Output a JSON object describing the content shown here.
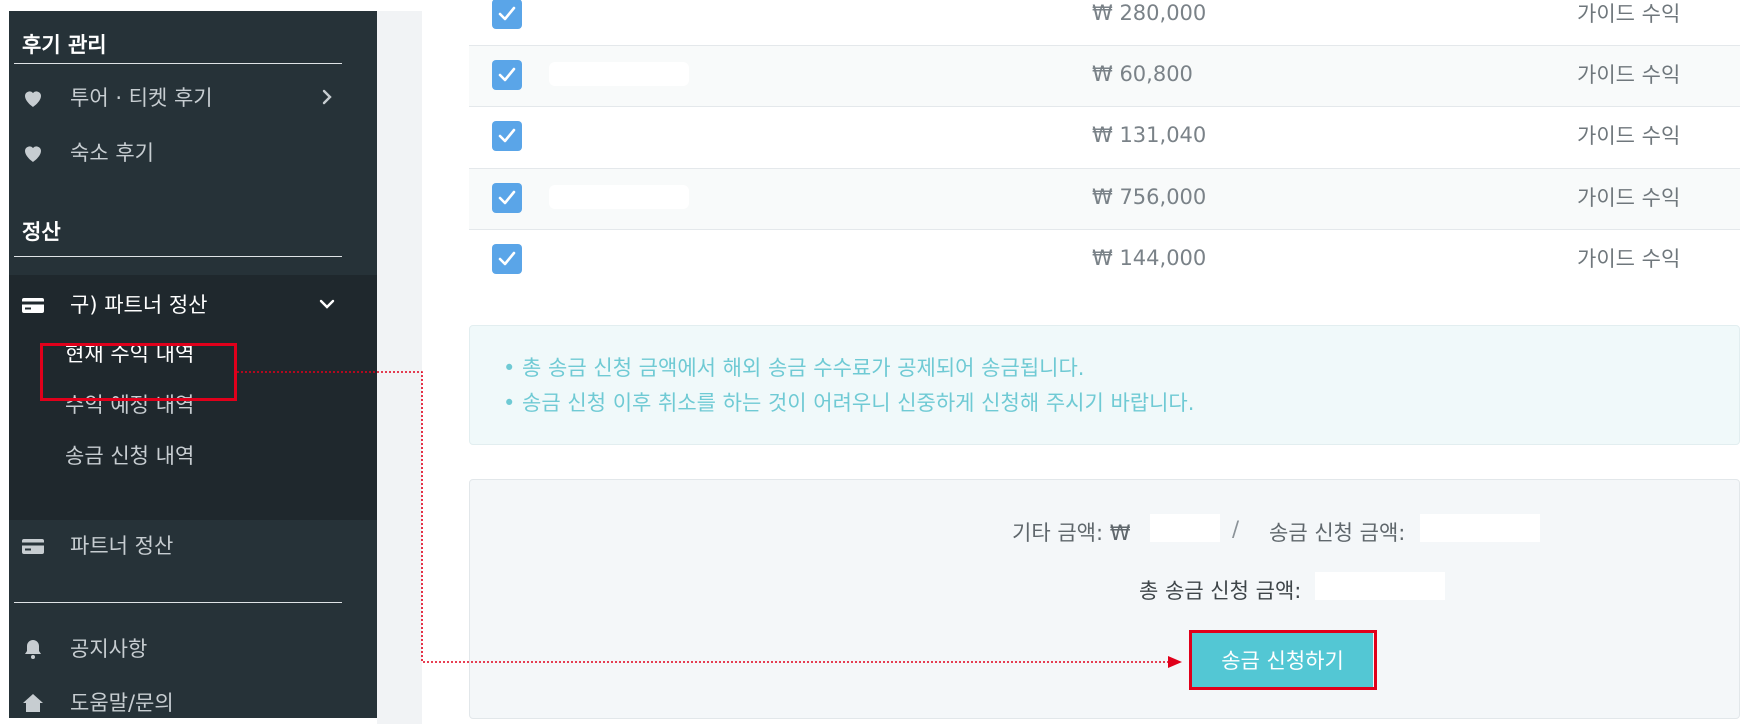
{
  "sidebar": {
    "reviews_title": "후기 관리",
    "items": {
      "tour_reviews": "투어 · 티켓 후기",
      "stay_reviews": "숙소 후기"
    },
    "settlement_title": "정산",
    "old_partner": "구) 파트너 정산",
    "sub_items": {
      "current": "현재 수익 내역",
      "expected": "수익 예정 내역",
      "remittance": "송금 신청 내역"
    },
    "partner_settlement": "파트너 정산",
    "notices": "공지사항",
    "help": "도움말/문의"
  },
  "table": {
    "rows": [
      {
        "amount": "₩ 280,000",
        "type": "가이드 수익"
      },
      {
        "amount": "₩ 60,800",
        "type": "가이드 수익"
      },
      {
        "amount": "₩ 131,040",
        "type": "가이드 수익"
      },
      {
        "amount": "₩ 756,000",
        "type": "가이드 수익"
      },
      {
        "amount": "₩ 144,000",
        "type": "가이드 수익"
      }
    ]
  },
  "notice": {
    "line1": "• 총 송금 신청 금액에서 해외 송금 수수료가 공제되어 송금됩니다.",
    "line2": "• 송금 신청 이후 취소를 하는 것이 어려우니 신중하게 신청해 주시기 바랍니다."
  },
  "summary": {
    "other_label": "기타 금액: ₩",
    "separator": "/",
    "request_label": "송금 신청 금액:",
    "total_label": "총 송금 신청 금액:",
    "submit_button": "송금 신청하기"
  },
  "colors": {
    "sidebar_bg": "#263238",
    "accent": "#53c7d4",
    "checkbox": "#5aa5e8",
    "highlight": "#e0001b"
  }
}
